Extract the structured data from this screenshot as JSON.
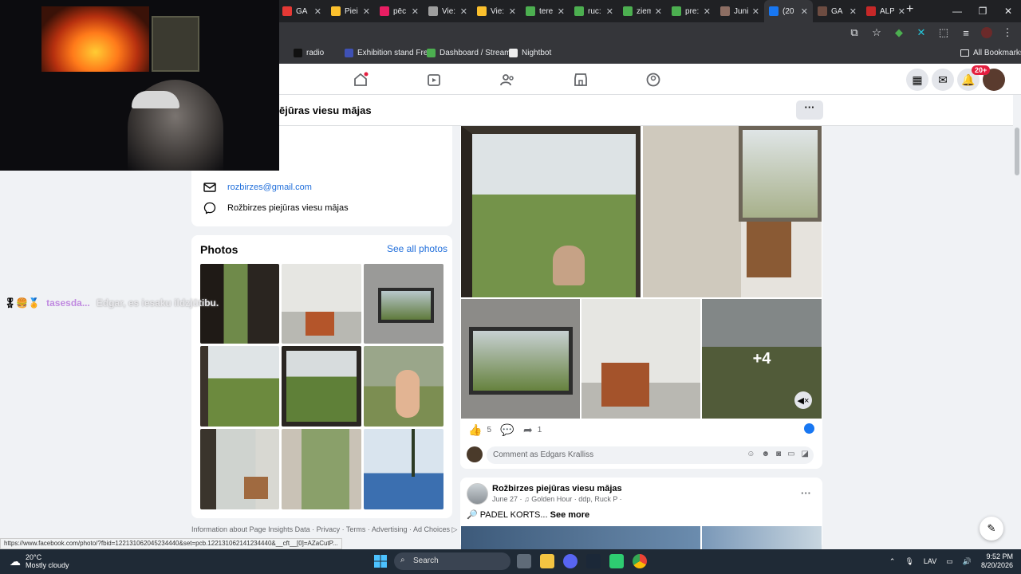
{
  "browser": {
    "tabs": [
      {
        "title": "GA",
        "color": "#e53935"
      },
      {
        "title": "Piei",
        "color": "#fbc02d"
      },
      {
        "title": "pēc",
        "color": "#e91e63"
      },
      {
        "title": "Vie:",
        "color": "#9e9e9e"
      },
      {
        "title": "Vie:",
        "color": "#fbc02d"
      },
      {
        "title": "tere",
        "color": "#4caf50"
      },
      {
        "title": "ruc:",
        "color": "#4caf50"
      },
      {
        "title": "ziem",
        "color": "#4caf50"
      },
      {
        "title": "pre:",
        "color": "#4caf50"
      },
      {
        "title": "Juni",
        "color": "#8d6e63"
      },
      {
        "title": "(20",
        "color": "#1877f2",
        "active": true
      },
      {
        "title": "GA",
        "color": "#6d4c41"
      },
      {
        "title": "ALP",
        "color": "#c62828"
      }
    ],
    "bookmarks": [
      {
        "label": "radio",
        "color": "#111111"
      },
      {
        "label": "Exhibition stand Fre...",
        "color": "#3f51b5"
      },
      {
        "label": "Dashboard / Stream...",
        "color": "#4caf50"
      },
      {
        "label": "Nightbot",
        "color": "#eeeeee"
      }
    ],
    "all_bookmarks": "All Bookmarks",
    "status_url": "https://www.facebook.com/photo/?fbid=122131062045234440&set=pcb.122131062141234440&__cft__[0]=AZaCutP..."
  },
  "facebook": {
    "notif_count": "20+",
    "page_title": "ējūras viesu mājas",
    "contact": {
      "email": "rozbirzes@gmail.com",
      "messenger": "Rožbirzes piejūras viesu mājas"
    },
    "photos": {
      "heading": "Photos",
      "see_all": "See all photos"
    },
    "footer": "Information about Page Insights Data · Privacy · Terms · Advertising · Ad Choices ▷",
    "post": {
      "more_count": "+4",
      "likes": "5",
      "shares": "1",
      "comment_placeholder": "Comment as Edgars Kralliss"
    },
    "post2": {
      "author": "Rožbirzes piejūras viesu mājas",
      "meta": "June 27 · ♫ Golden Hour · ddp, Ruck P ·",
      "text": "PADEL KORTS...",
      "see_more": "See more"
    }
  },
  "overlay": {
    "chat_user": "tasesda...",
    "chat_message": "Edgar, es iesaku ildzjūtibu."
  },
  "taskbar": {
    "temperature": "20°C",
    "weather": "Mostly cloudy",
    "search": "Search",
    "language": "LAV",
    "time": "9:52 PM",
    "date": "8/20/2026"
  }
}
